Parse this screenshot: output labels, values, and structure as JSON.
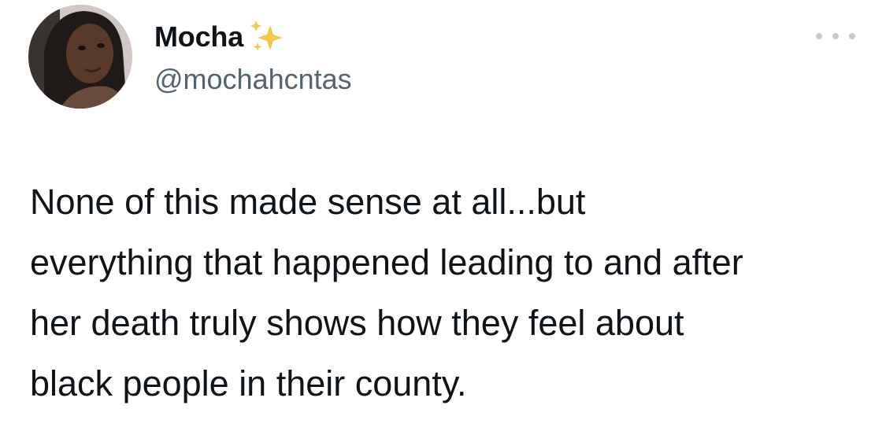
{
  "tweet": {
    "author": {
      "display_name": "Mocha",
      "name_emoji": "sparkles-icon",
      "handle": "@mochahcntas"
    },
    "text": "None of this made sense at all...but\neverything that happened leading to and after\nher death truly shows how they feel about\nblack people in their county.",
    "more_icon": "more-options-icon"
  },
  "colors": {
    "text_primary": "#0f1419",
    "text_secondary": "#536471",
    "sparkle_gold": "#f5c84c",
    "more_dots": "#c4c9ce"
  }
}
